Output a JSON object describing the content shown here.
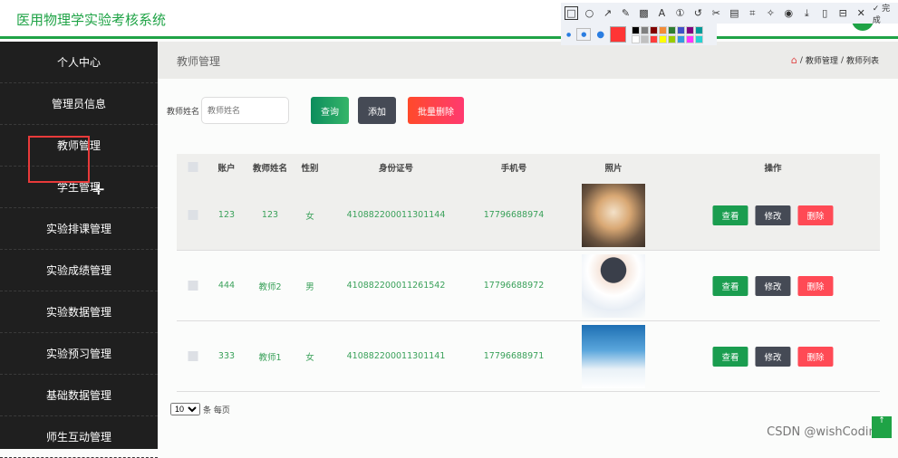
{
  "header": {
    "title": "医用物理学实验考核系统"
  },
  "sidebar": {
    "items": [
      "个人中心",
      "管理员信息",
      "教师管理",
      "学生管理",
      "实验排课管理",
      "实验成绩管理",
      "实验数据管理",
      "实验预习管理",
      "基础数据管理",
      "师生互动管理"
    ]
  },
  "page": {
    "title": "教师管理",
    "breadcrumb": [
      "教师管理",
      "教师列表"
    ]
  },
  "search": {
    "label": "教师姓名",
    "placeholder": "教师姓名",
    "query": "查询",
    "add": "添加",
    "batch_delete": "批量删除"
  },
  "table": {
    "headers": [
      "账户",
      "教师姓名",
      "性别",
      "身份证号",
      "手机号",
      "照片",
      "操作"
    ],
    "rows": [
      {
        "account": "123",
        "name": "123",
        "gender": "女",
        "id": "410882200011301144",
        "phone": "17796688974"
      },
      {
        "account": "444",
        "name": "教师2",
        "gender": "男",
        "id": "410882200011261542",
        "phone": "17796688972"
      },
      {
        "account": "333",
        "name": "教师1",
        "gender": "女",
        "id": "410882200011301141",
        "phone": "17796688971"
      }
    ],
    "actions": {
      "view": "查看",
      "edit": "修改",
      "delete": "删除"
    }
  },
  "pager": {
    "page_size": "10",
    "suffix": "条 每页"
  },
  "toolbar": {
    "done": "完成",
    "colors": [
      "#000000",
      "#808080",
      "#800000",
      "#f28c38",
      "#2e7d32",
      "#3f51c8",
      "#800080",
      "#009999",
      "#ffffff",
      "#c0c0c0",
      "#ff3b3b",
      "#ffff00",
      "#99cc00",
      "#3399e0",
      "#ff33ff",
      "#22d3d3"
    ],
    "current_color": "#ff3535"
  },
  "watermark": "CSDN @wishCoding",
  "back_top": "↑"
}
